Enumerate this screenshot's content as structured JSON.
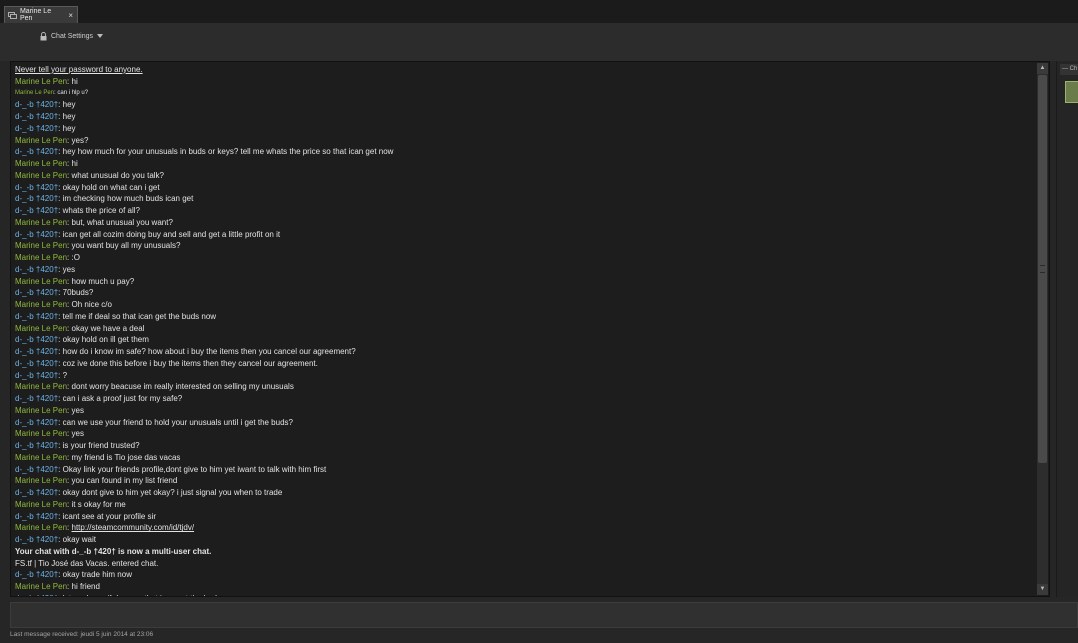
{
  "window": {
    "tab_title": "Marine Le Pen",
    "tab_close": "×"
  },
  "header": {
    "settings_label": "Chat Settings"
  },
  "chat": {
    "lines": [
      {
        "type": "link",
        "text": "Never tell your password to anyone."
      },
      {
        "type": "msg",
        "small": false,
        "sender": "Marine Le Pen",
        "who": "ml",
        "text": " hi"
      },
      {
        "type": "msg",
        "small": true,
        "sender": "Marine Le Pen",
        "who": "ml",
        "text": " can i hlp u?"
      },
      {
        "type": "msg",
        "sender": "d-_-b  †420†",
        "who": "db",
        "text": " hey"
      },
      {
        "type": "msg",
        "sender": "d-_-b  †420†",
        "who": "db",
        "text": " hey"
      },
      {
        "type": "msg",
        "sender": "d-_-b  †420†",
        "who": "db",
        "text": " hey"
      },
      {
        "type": "msg",
        "sender": "Marine Le Pen",
        "who": "ml",
        "text": " yes?"
      },
      {
        "type": "msg",
        "sender": "d-_-b  †420†",
        "who": "db",
        "text": " hey how much for your unusuals in buds or keys? tell me whats the price so that ican get now"
      },
      {
        "type": "msg",
        "sender": "Marine Le Pen",
        "who": "ml",
        "text": " hi"
      },
      {
        "type": "msg",
        "sender": "Marine Le Pen",
        "who": "ml",
        "text": " what unusual do you talk?"
      },
      {
        "type": "msg",
        "sender": "d-_-b  †420†",
        "who": "db",
        "text": " okay hold on what can i get"
      },
      {
        "type": "msg",
        "sender": "d-_-b  †420†",
        "who": "db",
        "text": " im checking how much buds ican get"
      },
      {
        "type": "msg",
        "sender": "d-_-b  †420†",
        "who": "db",
        "text": " whats the price of all?"
      },
      {
        "type": "msg",
        "sender": "Marine Le Pen",
        "who": "ml",
        "text": " but, what unusual you want?"
      },
      {
        "type": "msg",
        "sender": "d-_-b  †420†",
        "who": "db",
        "text": " ican get all cozim doing buy and sell and get a little profit on it"
      },
      {
        "type": "msg",
        "sender": "Marine Le Pen",
        "who": "ml",
        "text": " you want buy all my unusuals?"
      },
      {
        "type": "msg",
        "sender": "Marine Le Pen",
        "who": "ml",
        "text": " :O"
      },
      {
        "type": "msg",
        "sender": "d-_-b  †420†",
        "who": "db",
        "text": " yes"
      },
      {
        "type": "msg",
        "sender": "Marine Le Pen",
        "who": "ml",
        "text": " how much u pay?"
      },
      {
        "type": "msg",
        "sender": "d-_-b  †420†",
        "who": "db",
        "text": " 70buds?"
      },
      {
        "type": "msg",
        "sender": "Marine Le Pen",
        "who": "ml",
        "text": " Oh nice c/o"
      },
      {
        "type": "msg",
        "sender": "d-_-b  †420†",
        "who": "db",
        "text": " tell me if deal so that ican get the buds now"
      },
      {
        "type": "msg",
        "sender": "Marine Le Pen",
        "who": "ml",
        "text": " okay we have a deal"
      },
      {
        "type": "msg",
        "sender": "d-_-b  †420†",
        "who": "db",
        "text": " okay hold on ill get them"
      },
      {
        "type": "msg",
        "sender": "d-_-b  †420†",
        "who": "db",
        "text": " how do i know im safe? how about i buy the items then you cancel our agreement?"
      },
      {
        "type": "msg",
        "sender": "d-_-b  †420†",
        "who": "db",
        "text": " coz ive done this before i buy the items then they cancel our agreement."
      },
      {
        "type": "msg",
        "sender": "d-_-b  †420†",
        "who": "db",
        "text": " ?"
      },
      {
        "type": "msg",
        "sender": "Marine Le Pen",
        "who": "ml",
        "text": " dont worry beacuse im really interested on selling my unusuals"
      },
      {
        "type": "msg",
        "sender": "d-_-b  †420†",
        "who": "db",
        "text": " can i ask a proof just for my safe?"
      },
      {
        "type": "msg",
        "sender": "Marine Le Pen",
        "who": "ml",
        "text": " yes"
      },
      {
        "type": "msg",
        "sender": "d-_-b  †420†",
        "who": "db",
        "text": " can we use your friend to hold your unusuals until i get the buds?"
      },
      {
        "type": "msg",
        "sender": "Marine Le Pen",
        "who": "ml",
        "text": " yes"
      },
      {
        "type": "msg",
        "sender": "d-_-b  †420†",
        "who": "db",
        "text": " is your friend trusted?"
      },
      {
        "type": "msg",
        "sender": "Marine Le Pen",
        "who": "ml",
        "text": " my friend is Tio jose das vacas"
      },
      {
        "type": "msg",
        "sender": "d-_-b  †420†",
        "who": "db",
        "text": " Okay link your friends profile,dont give to him yet iwant to talk with him first"
      },
      {
        "type": "msg",
        "sender": "Marine Le Pen",
        "who": "ml",
        "text": " you can found in my list friend"
      },
      {
        "type": "msg",
        "sender": "d-_-b  †420†",
        "who": "db",
        "text": " okay dont give to him yet okay? i just signal you when to trade"
      },
      {
        "type": "msg",
        "sender": "Marine Le Pen",
        "who": "ml",
        "text": " it s okay for me"
      },
      {
        "type": "msg",
        "sender": "d-_-b  †420†",
        "who": "db",
        "text": " icant see at your profile sir"
      },
      {
        "type": "msglink",
        "sender": "Marine Le Pen",
        "who": "ml",
        "text": "http://steamcommunity.com/id/tjdv/"
      },
      {
        "type": "msg",
        "sender": "d-_-b  †420†",
        "who": "db",
        "text": " okay wait"
      },
      {
        "type": "sys",
        "text": "Your chat with d-_-b  †420†  is now a multi-user chat."
      },
      {
        "type": "plain",
        "text": "FS.tf | Tio José das Vacas. entered chat."
      },
      {
        "type": "msg",
        "sender": "d-_-b  †420†",
        "who": "db",
        "text": " okay trade him now"
      },
      {
        "type": "msg",
        "sender": "Marine Le Pen",
        "who": "ml",
        "text": " hi friend"
      },
      {
        "type": "msg",
        "sender": "d-_-b  †420†",
        "who": "db",
        "text": " let me know if deep so that ican get the buds now"
      }
    ]
  },
  "members": {
    "header_label": "— Ch"
  },
  "status": {
    "last_message": "Last message received: jeudi 5 juin 2014 at 23:06"
  }
}
